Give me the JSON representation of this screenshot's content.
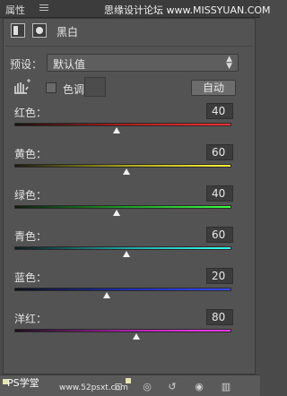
{
  "titlebar": {
    "title": "属性",
    "watermark": "思缘设计论坛 www.MISSYUAN.COM"
  },
  "adjustment": {
    "title": "黑白"
  },
  "preset": {
    "label": "预设：",
    "value": "默认值"
  },
  "tint": {
    "label": "色调"
  },
  "auto_button": {
    "label": "自动"
  },
  "sliders": [
    {
      "label": "红色：",
      "value": "40",
      "fraction": 0.47,
      "gradient": [
        "#1b1010",
        "#a71d1d",
        "#ff3030"
      ]
    },
    {
      "label": "黄色：",
      "value": "60",
      "fraction": 0.515,
      "gradient": [
        "#1a1a0f",
        "#a8a31a",
        "#fff23a"
      ]
    },
    {
      "label": "绿色：",
      "value": "40",
      "fraction": 0.47,
      "gradient": [
        "#0f1a10",
        "#1f9a26",
        "#3aff43"
      ]
    },
    {
      "label": "青色：",
      "value": "60",
      "fraction": 0.515,
      "gradient": [
        "#0f1a1a",
        "#1fa3a3",
        "#3afff6"
      ]
    },
    {
      "label": "蓝色：",
      "value": "20",
      "fraction": 0.425,
      "gradient": [
        "#0f0f1a",
        "#1c2ea6",
        "#3a4aff"
      ]
    },
    {
      "label": "洋红：",
      "value": "80",
      "fraction": 0.56,
      "gradient": [
        "#1a0f1a",
        "#a31fa3",
        "#ff3af7"
      ]
    }
  ],
  "bottom": {
    "brand": "PS学堂",
    "site": "www.52psxt.com"
  },
  "icons": [
    "layer-adjustment-icon",
    "mask-icon",
    "menu-icon",
    "hand-target-icon",
    "clip-icon",
    "view-previous-icon",
    "reset-icon",
    "visibility-eye-icon",
    "trash-icon"
  ]
}
